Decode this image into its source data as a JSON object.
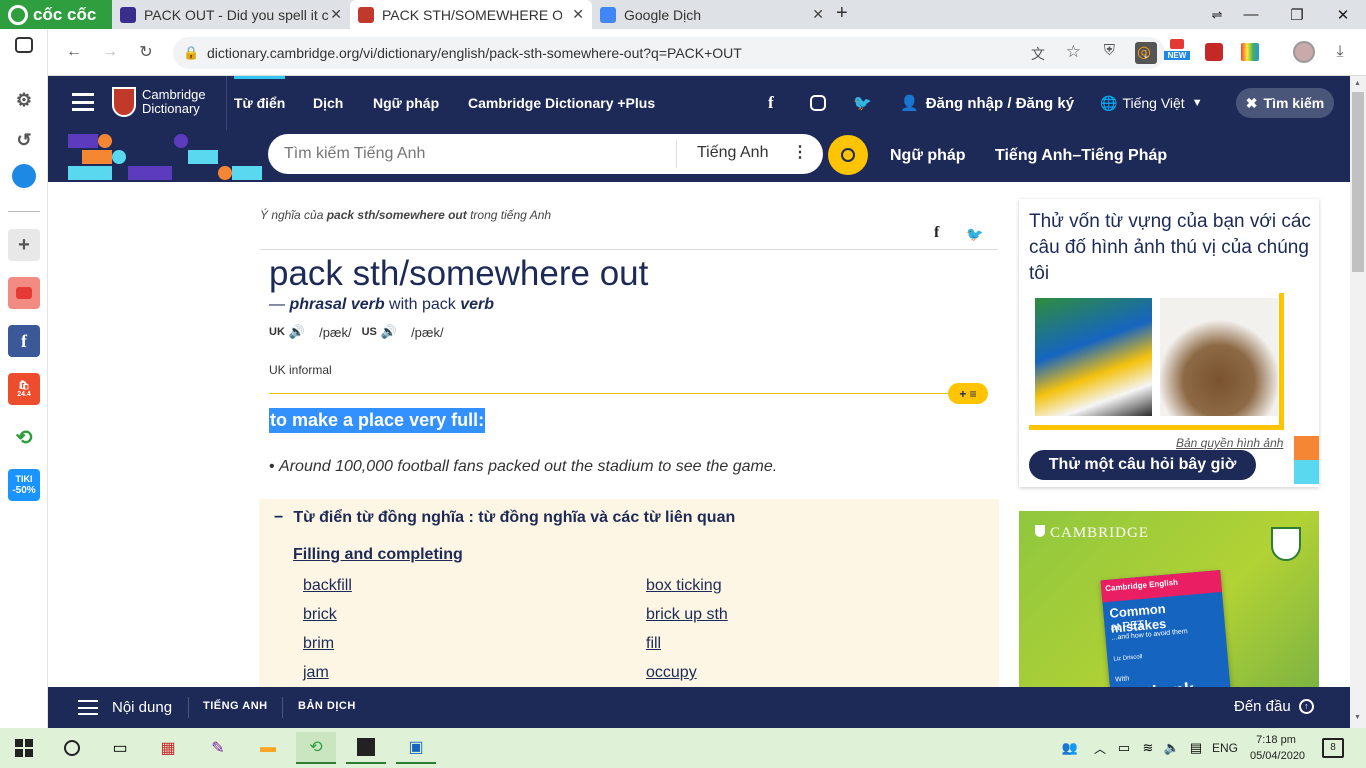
{
  "browser": {
    "brand": "cốc cốc",
    "tabs": [
      {
        "title": "PACK OUT - Did you spell it c",
        "color": "#3a2e8c"
      },
      {
        "title": "PACK STH/SOMEWHERE OUT",
        "color": "#c0392b"
      },
      {
        "title": "Google Dịch",
        "color": "#4285f4"
      }
    ],
    "new_tab": "+",
    "url": "dictionary.cambridge.org/vi/dictionary/english/pack-sth-somewhere-out?q=PACK+OUT",
    "new_badge": "NEW"
  },
  "sidebar": {
    "tiki_label": "TIKI",
    "tiki_discount": "-50%",
    "shopee_label": "24.4"
  },
  "site": {
    "logo_line1": "Cambridge",
    "logo_line2": "Dictionary",
    "nav": [
      "Từ điển",
      "Dịch",
      "Ngữ pháp",
      "Cambridge Dictionary +Plus"
    ],
    "login": "Đăng nhập / Đăng ký",
    "language": "Tiếng Việt",
    "search_btn": "Tìm kiếm",
    "search_placeholder": "Tìm kiếm Tiếng Anh",
    "search_lang": "Tiếng Anh",
    "sub_nav": [
      "Ngữ pháp",
      "Tiếng Anh–Tiếng Pháp"
    ]
  },
  "entry": {
    "breadcrumb_pre": "Ý nghĩa của ",
    "breadcrumb_word": "pack sth/somewhere out",
    "breadcrumb_post": " trong tiếng Anh",
    "headword": "pack sth/somewhere out",
    "pos_dash": "— ",
    "pos": "phrasal verb",
    "with": " with pack ",
    "with_pos": "verb",
    "uk": "UK",
    "uk_ipa": "/pæk/",
    "us": "US",
    "us_ipa": "/pæk/",
    "register": "UK informal",
    "definition": "to make a place very full:",
    "example": "Around 100,000 football fans packed out the stadium to see the game.",
    "thesaurus_title": "Từ điển từ đồng nghĩa : từ đồng nghĩa và các từ liên quan",
    "thesaurus_group": "Filling and completing",
    "words_left": [
      "backfill",
      "brick",
      "brim",
      "jam"
    ],
    "words_right": [
      "box ticking",
      "brick up sth",
      "fill",
      "occupy"
    ]
  },
  "quiz": {
    "title": "Thử vốn từ vựng của bạn với các câu đố hình ảnh thú vị của chúng tôi",
    "credit": "Bản quyền hình ảnh",
    "button": "Thử một câu hỏi bây giờ"
  },
  "ad": {
    "brand": "CAMBRIDGE",
    "book_series": "Cambridge English",
    "book_title": "Common mistakes",
    "book_sub1": "at PET",
    "book_sub2": "...and how to avoid them",
    "book_author": "Liz Driscoll",
    "book_with": "With",
    "book_bottom": "Testbank"
  },
  "bottom": {
    "menu": "Nội dung",
    "tab1": "TIẾNG ANH",
    "tab2": "BẢN DỊCH",
    "top": "Đến đầu"
  },
  "taskbar": {
    "lang": "ENG",
    "time": "7:18 pm",
    "date": "05/04/2020",
    "notif": "8"
  }
}
